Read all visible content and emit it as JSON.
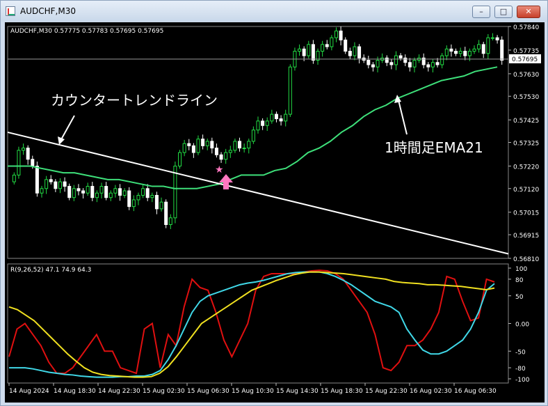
{
  "window": {
    "title": "AUDCHF,M30",
    "buttons": {
      "minimize": "–",
      "maximize": "□",
      "close": "✕"
    }
  },
  "colors": {
    "background": "#000000",
    "grid": "#2a2a2a",
    "axis_text": "#ffffff",
    "candle_up": "#22dd44",
    "candle_down": "#ffffff",
    "ema": "#3ee07a",
    "trendline": "#ffffff",
    "arrow": "#ff77c0",
    "osc_red": "#e01010",
    "osc_cyan": "#40d8e8",
    "osc_yellow": "#f0e020"
  },
  "chart_data": [
    {
      "type": "candlestick",
      "header": "AUDCHF,M30  0.57775 0.57783 0.57695 0.57695",
      "y_ticks": [
        "0.57840",
        "0.57735",
        "0.57630",
        "0.57530",
        "0.57425",
        "0.57325",
        "0.57220",
        "0.57120",
        "0.57015",
        "0.56915",
        "0.56810"
      ],
      "ylim": [
        0.5681,
        0.5784
      ],
      "current_price": "0.57695",
      "close_prices": [
        0.5718,
        0.5729,
        0.573,
        0.5725,
        0.5722,
        0.571,
        0.5712,
        0.5716,
        0.5715,
        0.5712,
        0.5715,
        0.5713,
        0.5708,
        0.5712,
        0.5711,
        0.571,
        0.5713,
        0.5708,
        0.571,
        0.5713,
        0.5708,
        0.571,
        0.5712,
        0.5709,
        0.5711,
        0.5704,
        0.5707,
        0.5709,
        0.5712,
        0.5708,
        0.5709,
        0.5703,
        0.5706,
        0.5696,
        0.5699,
        0.5722,
        0.5728,
        0.5732,
        0.5731,
        0.5728,
        0.5734,
        0.5731,
        0.5733,
        0.573,
        0.5727,
        0.5725,
        0.5728,
        0.5729,
        0.5733,
        0.573,
        0.573,
        0.5733,
        0.5738,
        0.5742,
        0.574,
        0.5742,
        0.5745,
        0.5743,
        0.5742,
        0.5745,
        0.5766,
        0.5773,
        0.5774,
        0.5771,
        0.5776,
        0.5769,
        0.5773,
        0.5776,
        0.5775,
        0.5779,
        0.5782,
        0.5778,
        0.5773,
        0.5771,
        0.5775,
        0.577,
        0.5769,
        0.5767,
        0.5766,
        0.5769,
        0.577,
        0.5768,
        0.5767,
        0.5771,
        0.577,
        0.5768,
        0.5766,
        0.5769,
        0.577,
        0.5767,
        0.5766,
        0.5768,
        0.5767,
        0.5771,
        0.5774,
        0.5773,
        0.5772,
        0.5773,
        0.5771,
        0.5773,
        0.5774,
        0.5776,
        0.5772,
        0.5779,
        0.5779,
        0.5778,
        0.5769
      ],
      "series": [
        {
          "name": "1時間足EMA21",
          "values": [
            0.5722,
            0.5722,
            0.5722,
            0.5721,
            0.572,
            0.5719,
            0.5719,
            0.5718,
            0.5717,
            0.5716,
            0.5716,
            0.5715,
            0.5714,
            0.5713,
            0.5713,
            0.5712,
            0.5712,
            0.5712,
            0.5713,
            0.5714,
            0.5716,
            0.5718,
            0.5718,
            0.5718,
            0.572,
            0.5721,
            0.5724,
            0.5728,
            0.573,
            0.5733,
            0.5737,
            0.574,
            0.5744,
            0.5747,
            0.5749,
            0.5752,
            0.5754,
            0.5756,
            0.5758,
            0.576,
            0.5761,
            0.5762,
            0.5764,
            0.5765,
            0.5766
          ]
        }
      ],
      "trendline": [
        [
          0,
          0.5737
        ],
        [
          1,
          0.5683
        ]
      ],
      "annotations": [
        "カウンタートレンドライン",
        "1時間足EMA21"
      ]
    },
    {
      "type": "line",
      "header": "R(9,26,52) 47.1 74.9 64.3",
      "y_ticks": [
        "100",
        "80",
        "50",
        "0.00",
        "-50",
        "-80",
        "-100"
      ],
      "ylim": [
        -100,
        100
      ],
      "series": [
        {
          "values": [
            -60,
            -10,
            0,
            -20,
            -40,
            -70,
            -90,
            -90,
            -80,
            -60,
            -40,
            -20,
            -50,
            -50,
            -80,
            -85,
            -90,
            -10,
            0,
            -80,
            -20,
            -40,
            30,
            80,
            65,
            60,
            20,
            -30,
            -60,
            -30,
            0,
            60,
            85,
            90,
            90,
            90,
            90,
            93,
            95,
            96,
            95,
            90,
            80,
            60,
            40,
            20,
            -20,
            -80,
            -85,
            -70,
            -40,
            -40,
            -30,
            -10,
            20,
            85,
            80,
            40,
            5,
            10,
            80,
            75
          ]
        },
        {
          "values": [
            -80,
            -80,
            -80,
            -82,
            -85,
            -88,
            -90,
            -92,
            -93,
            -95,
            -96,
            -97,
            -97,
            -97,
            -96,
            -96,
            -95,
            -95,
            -92,
            -85,
            -65,
            -40,
            -10,
            20,
            40,
            50,
            55,
            60,
            65,
            70,
            73,
            75,
            78,
            82,
            86,
            90,
            92,
            93,
            93,
            93,
            90,
            85,
            78,
            70,
            60,
            50,
            40,
            35,
            30,
            20,
            -10,
            -30,
            -48,
            -55,
            -55,
            -50,
            -40,
            -30,
            -10,
            20,
            60,
            72
          ]
        },
        {
          "values": [
            30,
            25,
            15,
            5,
            -10,
            -25,
            -40,
            -55,
            -68,
            -80,
            -88,
            -92,
            -94,
            -95,
            -96,
            -97,
            -97,
            -96,
            -90,
            -78,
            -60,
            -40,
            -20,
            0,
            10,
            20,
            30,
            40,
            50,
            60,
            66,
            72,
            78,
            83,
            88,
            91,
            93,
            93,
            92,
            91,
            90,
            88,
            86,
            84,
            82,
            80,
            76,
            74,
            73,
            72,
            70,
            70,
            69,
            68,
            67,
            65,
            63,
            61,
            64
          ]
        }
      ]
    }
  ],
  "x_labels": [
    "14 Aug 2024",
    "14 Aug 18:30",
    "14 Aug 22:30",
    "15 Aug 02:30",
    "15 Aug 06:30",
    "15 Aug 10:30",
    "15 Aug 14:30",
    "15 Aug 18:30",
    "15 Aug 22:30",
    "16 Aug 02:30",
    "16 Aug 06:30"
  ]
}
